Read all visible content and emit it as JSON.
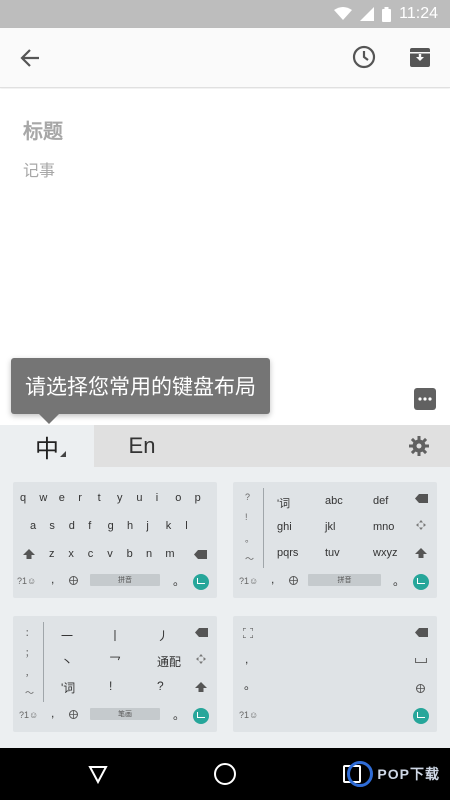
{
  "status_bar": {
    "time": "11:24",
    "icons": [
      "wifi-icon",
      "signal-icon",
      "battery-icon"
    ]
  },
  "app_bar": {
    "icons": [
      "back-arrow-icon",
      "reminder-clock-icon",
      "archive-icon"
    ]
  },
  "note": {
    "title_placeholder": "标题",
    "body_placeholder": "记事"
  },
  "tooltip": {
    "text": "请选择您常用的键盘布局"
  },
  "layout_tabs": {
    "chinese": "中",
    "english": "En"
  },
  "keyboards": {
    "qwerty": {
      "row1": [
        "q",
        "w",
        "e",
        "r",
        "t",
        "y",
        "u",
        "i",
        "o",
        "p"
      ],
      "row2": [
        "a",
        "s",
        "d",
        "f",
        "g",
        "h",
        "j",
        "k",
        "l"
      ],
      "row3": [
        "z",
        "x",
        "c",
        "v",
        "b",
        "n",
        "m"
      ],
      "sym": "?1☺",
      "comma": ",",
      "space": "拼音",
      "period": "。"
    },
    "t9": {
      "cells": [
        "'词",
        "abc",
        "def",
        "ghi",
        "jkl",
        "mno",
        "pqrs",
        "tuv",
        "wxyz"
      ],
      "left_col": [
        "?",
        "!",
        "。",
        "～"
      ],
      "sym": "?1☺",
      "comma": ",",
      "space": "拼音",
      "period": "。"
    },
    "stroke": {
      "cells": [
        "一",
        "丨",
        "丿",
        "丶",
        "乛",
        "通配",
        "'词",
        "!",
        "?"
      ],
      "left_col": [
        "：",
        "；",
        "，",
        "～"
      ],
      "sym": "?1☺",
      "comma": ",",
      "space": "笔画",
      "period": "。"
    },
    "handwriting": {
      "left_col": [
        ",",
        "。"
      ],
      "sym": "?1☺"
    }
  },
  "colors": {
    "accent": "#26a69a",
    "tooltip_bg": "#757575",
    "status_bar": "#bdbdbd",
    "nav_bar": "#000000"
  },
  "watermark": {
    "text": "POP下载"
  }
}
